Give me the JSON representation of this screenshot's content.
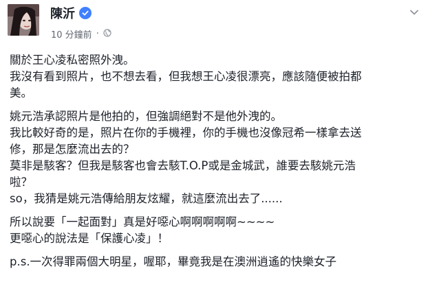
{
  "post": {
    "author": "陳沂",
    "verified_icon": "verified-badge-icon",
    "time": "10 分鐘前",
    "dot": "·",
    "privacy_icon": "globe-icon",
    "menu_icon": "chevron-down-icon",
    "paragraphs": [
      {
        "lines": [
          "關於王心凌私密照外洩。",
          "我沒有看到照片，也不想去看，但我想王心凌很漂亮，應該隨便被拍都",
          "美。"
        ]
      },
      {
        "lines": [
          "姚元浩承認照片是他拍的，但強調絕對不是他外洩的。",
          "我比較好奇的是，照片在你的手機裡，你的手機也沒像冠希一樣拿去送",
          "修，那是怎麼流出去的？",
          "莫非是駭客？但我是駭客也會去駭T.O.P或是金城武，誰要去駭姚元浩",
          "啦？",
          "so，我猜是姚元浩傳給朋友炫耀，就這麼流出去了......"
        ]
      },
      {
        "lines": [
          "所以說要「一起面對」真是好噁心啊啊啊啊啊~~~~",
          "更噁心的說法是「保護心凌」！"
        ]
      },
      {
        "lines": [
          "p.s.一次得罪兩個大明星，喔耶，畢竟我是在澳洲逍遙的快樂女子"
        ]
      }
    ]
  }
}
